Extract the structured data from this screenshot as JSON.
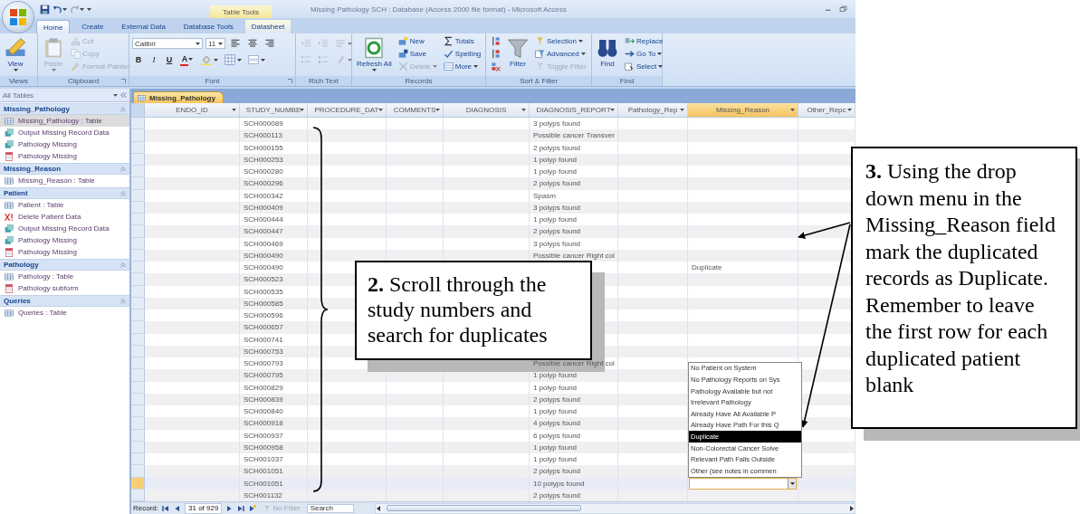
{
  "window": {
    "title": "Missing Pathology SCH : Database (Access 2000 file format) - Microsoft Access",
    "contextual_group": "Table Tools"
  },
  "ribbon_tabs": [
    {
      "label": "Home",
      "selected": true,
      "contextual": false
    },
    {
      "label": "Create",
      "selected": false,
      "contextual": false
    },
    {
      "label": "External Data",
      "selected": false,
      "contextual": false
    },
    {
      "label": "Database Tools",
      "selected": false,
      "contextual": false
    },
    {
      "label": "Datasheet",
      "selected": false,
      "contextual": true
    }
  ],
  "ribbon_groups": [
    {
      "label": "Views",
      "kind": "stack",
      "launcher": false,
      "sections": [
        [
          {
            "kind": "large",
            "label": "View",
            "caret": true,
            "disabled": false
          }
        ]
      ]
    },
    {
      "label": "Clipboard",
      "kind": "stack",
      "launcher": true,
      "sections": [
        [
          {
            "kind": "large",
            "label": "Paste",
            "caret": true,
            "disabled": true
          }
        ],
        [
          {
            "kind": "small",
            "label": "Cut",
            "caret": false,
            "disabled": true
          },
          {
            "kind": "small",
            "label": "Copy",
            "caret": false,
            "disabled": true
          },
          {
            "kind": "small",
            "label": "Format Painter",
            "caret": false,
            "disabled": true
          }
        ]
      ]
    },
    {
      "label": "Font",
      "kind": "grid",
      "launcher": true,
      "sections": [
        [
          {
            "kind": "field",
            "value": "Calibri"
          },
          {
            "kind": "field",
            "value": "11"
          },
          {
            "kind": "icon",
            "caret": false,
            "disabled": false
          },
          {
            "kind": "icon",
            "caret": false,
            "disabled": false
          },
          {
            "kind": "icon",
            "caret": false,
            "disabled": false
          }
        ],
        [
          {
            "kind": "text",
            "label": "B",
            "caret": false
          },
          {
            "kind": "text",
            "label": "I",
            "caret": false
          },
          {
            "kind": "text",
            "label": "U",
            "caret": false
          },
          {
            "kind": "text",
            "label": "A",
            "caret": true
          },
          {
            "kind": "icon",
            "caret": true,
            "disabled": false
          },
          {
            "kind": "icon",
            "caret": true,
            "disabled": false
          },
          {
            "kind": "icon",
            "caret": true,
            "disabled": false
          }
        ]
      ]
    },
    {
      "label": "Rich Text",
      "kind": "grid",
      "launcher": false,
      "sections": [
        [
          {
            "kind": "icon",
            "caret": false,
            "disabled": true
          },
          {
            "kind": "icon",
            "caret": false,
            "disabled": true
          },
          {
            "kind": "icon",
            "caret": true,
            "disabled": true
          }
        ],
        [
          {
            "kind": "icon",
            "caret": false,
            "disabled": true
          },
          {
            "kind": "icon",
            "caret": false,
            "disabled": true
          },
          {
            "kind": "icon",
            "caret": true,
            "disabled": true
          }
        ]
      ]
    },
    {
      "label": "Records",
      "kind": "stack",
      "launcher": false,
      "sections": [
        [
          {
            "kind": "large",
            "label": "Refresh All",
            "caret": true,
            "disabled": false
          }
        ],
        [
          {
            "kind": "small",
            "label": "New",
            "caret": false,
            "disabled": false
          },
          {
            "kind": "small",
            "label": "Save",
            "caret": false,
            "disabled": false
          },
          {
            "kind": "small",
            "label": "Delete",
            "caret": true,
            "disabled": true
          }
        ],
        [
          {
            "kind": "small",
            "label": "Totals",
            "caret": false,
            "disabled": false
          },
          {
            "kind": "small",
            "label": "Spelling",
            "caret": false,
            "disabled": false
          },
          {
            "kind": "small",
            "label": "More",
            "caret": true,
            "disabled": false
          }
        ]
      ]
    },
    {
      "label": "Sort & Filter",
      "kind": "stack",
      "launcher": false,
      "sections": [
        [
          {
            "kind": "icon",
            "caret": false,
            "disabled": false
          },
          {
            "kind": "icon",
            "caret": false,
            "disabled": false
          },
          {
            "kind": "icon",
            "caret": false,
            "disabled": false
          }
        ],
        [
          {
            "kind": "large",
            "label": "Filter",
            "caret": false,
            "disabled": false
          }
        ],
        [
          {
            "kind": "small",
            "label": "Selection",
            "caret": true,
            "disabled": false
          },
          {
            "kind": "small",
            "label": "Advanced",
            "caret": true,
            "disabled": false
          },
          {
            "kind": "small",
            "label": "Toggle Filter",
            "caret": false,
            "disabled": true
          }
        ]
      ]
    },
    {
      "label": "Find",
      "kind": "stack",
      "launcher": false,
      "sections": [
        [
          {
            "kind": "large",
            "label": "Find",
            "caret": false,
            "disabled": false
          }
        ],
        [
          {
            "kind": "small",
            "label": "Replace",
            "caret": false,
            "disabled": false
          },
          {
            "kind": "small",
            "label": "Go To",
            "caret": true,
            "disabled": false
          },
          {
            "kind": "small",
            "label": "Select",
            "caret": true,
            "disabled": false
          }
        ]
      ]
    }
  ],
  "navigation_pane": {
    "title": "All Tables",
    "groups": [
      {
        "label": "Missing_Pathology",
        "expanded": true,
        "items": [
          {
            "label": "Missing_Pathology : Table",
            "kind": "table",
            "selected": true
          },
          {
            "label": "Output Missing Record Data",
            "kind": "query",
            "selected": false
          },
          {
            "label": "Pathology Missing",
            "kind": "query",
            "selected": false
          },
          {
            "label": "Pathology Missing",
            "kind": "form",
            "selected": false
          }
        ]
      },
      {
        "label": "Missing_Reason",
        "expanded": true,
        "items": [
          {
            "label": "Missing_Reason : Table",
            "kind": "table",
            "selected": false
          }
        ]
      },
      {
        "label": "Patient",
        "expanded": true,
        "items": [
          {
            "label": "Patient : Table",
            "kind": "table",
            "selected": false
          },
          {
            "label": "Delete Patient Data",
            "kind": "delete",
            "selected": false
          },
          {
            "label": "Output Missing Record Data",
            "kind": "query",
            "selected": false
          },
          {
            "label": "Pathology Missing",
            "kind": "query",
            "selected": false
          },
          {
            "label": "Pathology Missing",
            "kind": "form",
            "selected": false
          }
        ]
      },
      {
        "label": "Pathology",
        "expanded": true,
        "items": [
          {
            "label": "Pathology : Table",
            "kind": "table",
            "selected": false
          },
          {
            "label": "Pathology subform",
            "kind": "form",
            "selected": false
          }
        ]
      },
      {
        "label": "Queries",
        "expanded": true,
        "items": [
          {
            "label": "Queries : Table",
            "kind": "table",
            "selected": false
          }
        ]
      }
    ]
  },
  "document_tab": {
    "label": "Missing_Pathology"
  },
  "table": {
    "columns": [
      {
        "label": "ENDO_ID",
        "selected": false
      },
      {
        "label": "STUDY_NUMBE",
        "selected": false
      },
      {
        "label": "PROCEDURE_DAT",
        "selected": false
      },
      {
        "label": "COMMENTS",
        "selected": false
      },
      {
        "label": "DIAGNOSIS",
        "selected": false
      },
      {
        "label": "DIAGNOSIS_REPORT",
        "selected": false
      },
      {
        "label": "Pathology_Rep",
        "selected": false
      },
      {
        "label": "Missing_Reason",
        "selected": true
      },
      {
        "label": "Other_Repc",
        "selected": false
      }
    ],
    "rows": [
      {
        "study_number": "SCH000089",
        "diagnosis_report": "3 polyps found",
        "selected": false
      },
      {
        "study_number": "SCH000113",
        "diagnosis_report": "Possible cancer Transver",
        "selected": false
      },
      {
        "study_number": "SCH000155",
        "diagnosis_report": "2 polyps found",
        "selected": false
      },
      {
        "study_number": "SCH000253",
        "diagnosis_report": "1 polyp found",
        "selected": false
      },
      {
        "study_number": "SCH000280",
        "diagnosis_report": "1 polyp found",
        "selected": false
      },
      {
        "study_number": "SCH000296",
        "diagnosis_report": "2 polyps found",
        "selected": false
      },
      {
        "study_number": "SCH000342",
        "diagnosis_report": "Spasm",
        "selected": false
      },
      {
        "study_number": "SCH000409",
        "diagnosis_report": "3 polyps found",
        "selected": false
      },
      {
        "study_number": "SCH000444",
        "diagnosis_report": "1 polyp found",
        "selected": false
      },
      {
        "study_number": "SCH000447",
        "diagnosis_report": "2 polyps found",
        "selected": false
      },
      {
        "study_number": "SCH000469",
        "diagnosis_report": "3 polyps found",
        "selected": false
      },
      {
        "study_number": "SCH000490",
        "diagnosis_report": "Possible cancer Right col",
        "selected": false
      },
      {
        "study_number": "SCH000490",
        "missing_reason": "Duplicate",
        "selected": false
      },
      {
        "study_number": "SCH000523",
        "selected": false
      },
      {
        "study_number": "SCH000535",
        "selected": false
      },
      {
        "study_number": "SCH000585",
        "selected": false
      },
      {
        "study_number": "SCH000596",
        "selected": false
      },
      {
        "study_number": "SCH000657",
        "selected": false
      },
      {
        "study_number": "SCH000741",
        "selected": false
      },
      {
        "study_number": "SCH000753",
        "selected": false
      },
      {
        "study_number": "SCH000793",
        "diagnosis_report": "Possible cancer Right col",
        "selected": false
      },
      {
        "study_number": "SCH000795",
        "diagnosis_report": "1 polyp found",
        "selected": false
      },
      {
        "study_number": "SCH000829",
        "diagnosis_report": "1 polyp found",
        "selected": false
      },
      {
        "study_number": "SCH000839",
        "diagnosis_report": "2 polyps found",
        "selected": false
      },
      {
        "study_number": "SCH000840",
        "diagnosis_report": "1 polyp found",
        "selected": false
      },
      {
        "study_number": "SCH000918",
        "diagnosis_report": "4 polyps found",
        "selected": false
      },
      {
        "study_number": "SCH000937",
        "diagnosis_report": "6 polyps found",
        "selected": false
      },
      {
        "study_number": "SCH000958",
        "diagnosis_report": "1 polyp found",
        "selected": false
      },
      {
        "study_number": "SCH001037",
        "diagnosis_report": "1 polyp found",
        "selected": false
      },
      {
        "study_number": "SCH001051",
        "diagnosis_report": "2 polyps found",
        "selected": false
      },
      {
        "study_number": "SCH001051",
        "diagnosis_report": "10 polyps found",
        "selected": true
      },
      {
        "study_number": "SCH001132",
        "diagnosis_report": "2 polyps found",
        "selected": false
      }
    ]
  },
  "missing_reason_dropdown": {
    "options": [
      {
        "label": "No Patient on System",
        "selected": false
      },
      {
        "label": "No Pathology Reports on Sys",
        "selected": false
      },
      {
        "label": "Pathology Available but not",
        "selected": false
      },
      {
        "label": "Irrelevant Pathology",
        "selected": false
      },
      {
        "label": "Already Have All Available P",
        "selected": false
      },
      {
        "label": "Already Have Path For this Q",
        "selected": false
      },
      {
        "label": "Duplicate",
        "selected": true
      },
      {
        "label": "Non-Colorectal Cancer Solve",
        "selected": false
      },
      {
        "label": "Relevant Path Falls Outside",
        "selected": false
      },
      {
        "label": "Other (see notes in commen",
        "selected": false
      }
    ]
  },
  "status_bar": {
    "record_label": "Record:",
    "record_position": "31 of 929",
    "filter": "No Filter",
    "filter_on": false,
    "search_placeholder": "Search"
  },
  "callouts": [
    {
      "text": "**2.** Scroll through the study numbers and search for duplicates"
    },
    {
      "text": "**3.** Using the drop down menu in the Missing_Reason field mark the duplicated records as Duplicate. Remember to leave the first row for each duplicated patient blank"
    }
  ]
}
